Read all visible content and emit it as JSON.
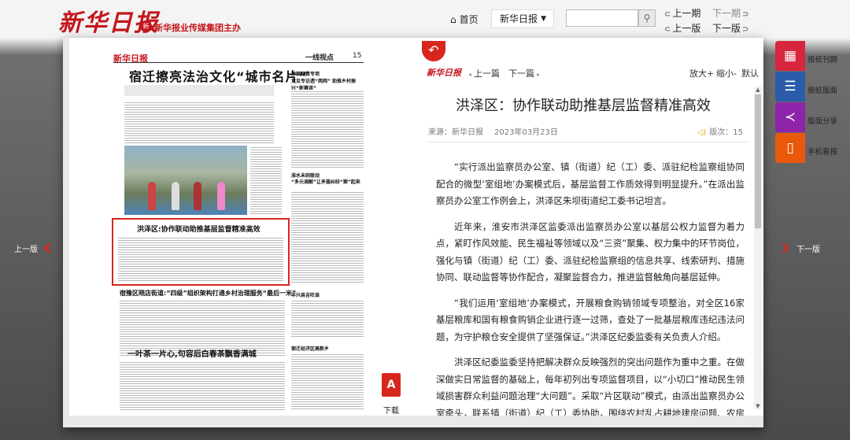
{
  "header": {
    "logo": "新华日报",
    "group_mark": "新",
    "group_name": "新华报业传媒集团主办",
    "home_label": "首页",
    "paper_select": "新华日报",
    "search_placeholder": "",
    "prev_issue": "上一期",
    "next_issue": "下一期",
    "prev_edition": "上一版",
    "next_edition": "下一版"
  },
  "scan": {
    "masthead": "新华日报",
    "page_header": "一线视点",
    "page_number": "15",
    "main_title": "宿迁擦亮法治文化“城市名片”",
    "side_title_1": "涉案结算专项",
    "side_title_2": "竞见专访透“两网”  助推乡村振兴“新赛道”",
    "side_title_3": "淮水未则联动",
    "side_title_4": "“多元调解”让矛盾纠纷“案”起来",
    "highlight_title": "洪泽区:协作联动助推基层监督精准高效",
    "section2_title": "宿豫区晓店街道:“四级”组织架构打通乡村治理服务“最后一米”",
    "section3_title": "一叶茶一片心,句容后白春茶飘香满城",
    "section4_title": "丰兴县吉旺谈",
    "section5_title": "宿迁经济区高新乡"
  },
  "pdf": {
    "label": "下载",
    "icon": "pdf-icon"
  },
  "article": {
    "mini_logo": "新华日报",
    "prev_article": "上一篇",
    "next_article": "下一篇",
    "font_larger": "放大+",
    "font_smaller": "缩小-",
    "font_default": "默认",
    "title": "洪泽区：协作联动助推基层监督精准高效",
    "source": "来源：新华日报",
    "date": "2023年03月23日",
    "edition": "版次：15",
    "paragraphs": [
      "“实行派出监察员办公室、镇（街道）纪（工）委、派驻纪检监察组协同配合的微型‘室组地’办案模式后，基层监督工作质效得到明显提升。”在派出监察员办公室工作例会上，洪泽区朱坝街道纪工委书记坦言。",
      "近年来，淮安市洪泽区监委派出监察员办公室以基层公权力监督为着力点，紧盯作风效能、民生福祉等领域以及“三资”聚集、权力集中的环节岗位，强化与镇（街道）纪（工）委、派驻纪检监察组的信息共享、线索研判、措施协同、联动监督等协作配合，凝聚监督合力，推进监督触角向基层延伸。",
      "“我们运用‘室组地’办案模式，开展粮食购销领域专项整治，对全区16家基层粮库和国有粮食购销企业进行逐一过筛，查处了一批基层粮库违纪违法问题，为守护粮仓安全提供了坚强保证。”洪泽区纪委监委有关负责人介绍。",
      "洪泽区纪委监委坚持把解决群众反映强烈的突出问题作为重中之重。在做深做实日常监督的基础上，每年初列出专项监督项目，以“小切口”推动民生领域损害群众利益问题治理“大问题”。采取“片区联动”模式，由派出监察员办公室牵头，联系镇（街道）纪（工）委协助，围绕农村乱占耕地建房问题、农房改善后续管理、国有“三资”管理、农村污水处理等开展专项监督。"
    ]
  },
  "nav": {
    "prev_edition_side": "上一版",
    "next_edition_side": "下一版"
  },
  "toolbar": [
    {
      "label": "报纸刊期",
      "icon": "calendar-icon",
      "color": "#d7263d"
    },
    {
      "label": "报纸版面",
      "icon": "list-icon",
      "color": "#2a5caa"
    },
    {
      "label": "版面分享",
      "icon": "share-icon",
      "color": "#8e24aa"
    },
    {
      "label": "手机看报",
      "icon": "mobile-icon",
      "color": "#e8590c"
    }
  ]
}
